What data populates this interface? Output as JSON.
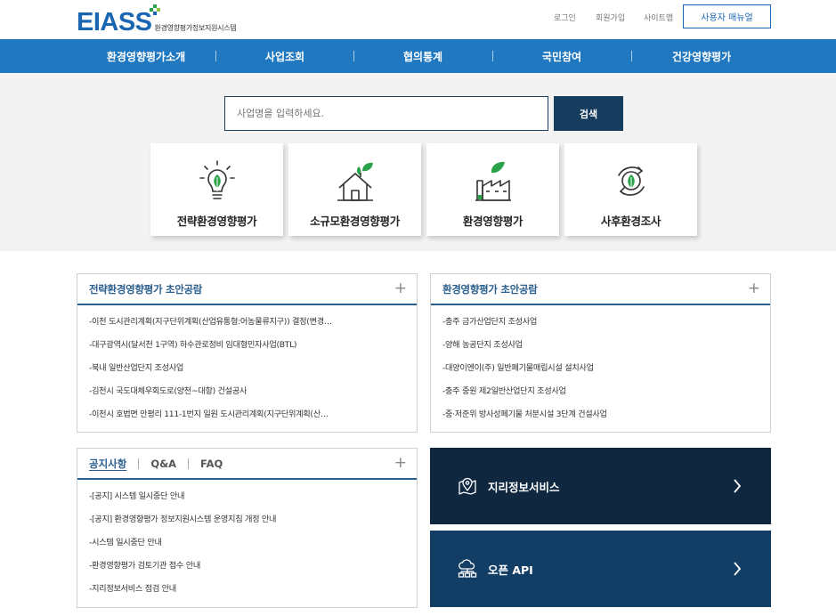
{
  "logo": {
    "name": "EIASS",
    "subtitle": "환경영향평가정보지원시스템"
  },
  "util_links": [
    "로그인",
    "회원가입",
    "사이트맵"
  ],
  "manual_button": "사용자 매뉴얼",
  "gnb": [
    "환경영향평가소개",
    "사업조회",
    "협의통계",
    "국민참여",
    "건강영향평가"
  ],
  "search": {
    "placeholder": "사업명을 입력하세요.",
    "button": "검색"
  },
  "cards": [
    "전략환경영향평가",
    "소규모환경영향평가",
    "환경영향평가",
    "사후환경조사"
  ],
  "panels": {
    "strategic": {
      "title": "전략환경영향평가 초안공람",
      "items": [
        "-이천 도시관리계획(지구단위계획(산업유통형:어농물류지구)) 결정(변경…",
        "-대구광역시(달서천 1구역) 하수관로정비 임대형민자사업(BTL)",
        "-북내 일반산업단지 조성사업",
        "-김천시 국도대체우회도로(양천~대항) 건설공사",
        "-이천시 호법면 안평리 111-1번지 일원 도시관리계획(지구단위계획(산…"
      ]
    },
    "eia": {
      "title": "환경영향평가 초안공람",
      "items": [
        "-충주 금가산업단지 조성사업",
        "-양해 농공단지 조성사업",
        "-대양이엔이(주) 일반폐기물매립시설 설치사업",
        "-충주 중원 제2일반산업단지 조성사업",
        "-중·저준위 방사성폐기물 처분시설 3단계 건설사업"
      ]
    },
    "notice": {
      "tabs": [
        "공지사항",
        "Q&A",
        "FAQ"
      ],
      "items": [
        "-[공지] 시스템 일시중단 안내",
        "-[공지] 환경영향평가 정보지원시스템 운영지침 개정 안내",
        "-시스템 일시중단 안내",
        "-환경영향평가 검토기관 접수 안내",
        "-지리정보서비스 점검 안내"
      ]
    }
  },
  "services": [
    {
      "label": "지리정보서비스",
      "icon": "map-pin-icon",
      "color": "#0f2840"
    },
    {
      "label": "오픈 API",
      "icon": "cloud-network-icon",
      "color": "#123e66"
    }
  ],
  "colors": {
    "brand": "#1b66b2",
    "gnb": "#2079c0",
    "accent_green": "#2aa24a",
    "dark_navy": "#163d5e"
  }
}
